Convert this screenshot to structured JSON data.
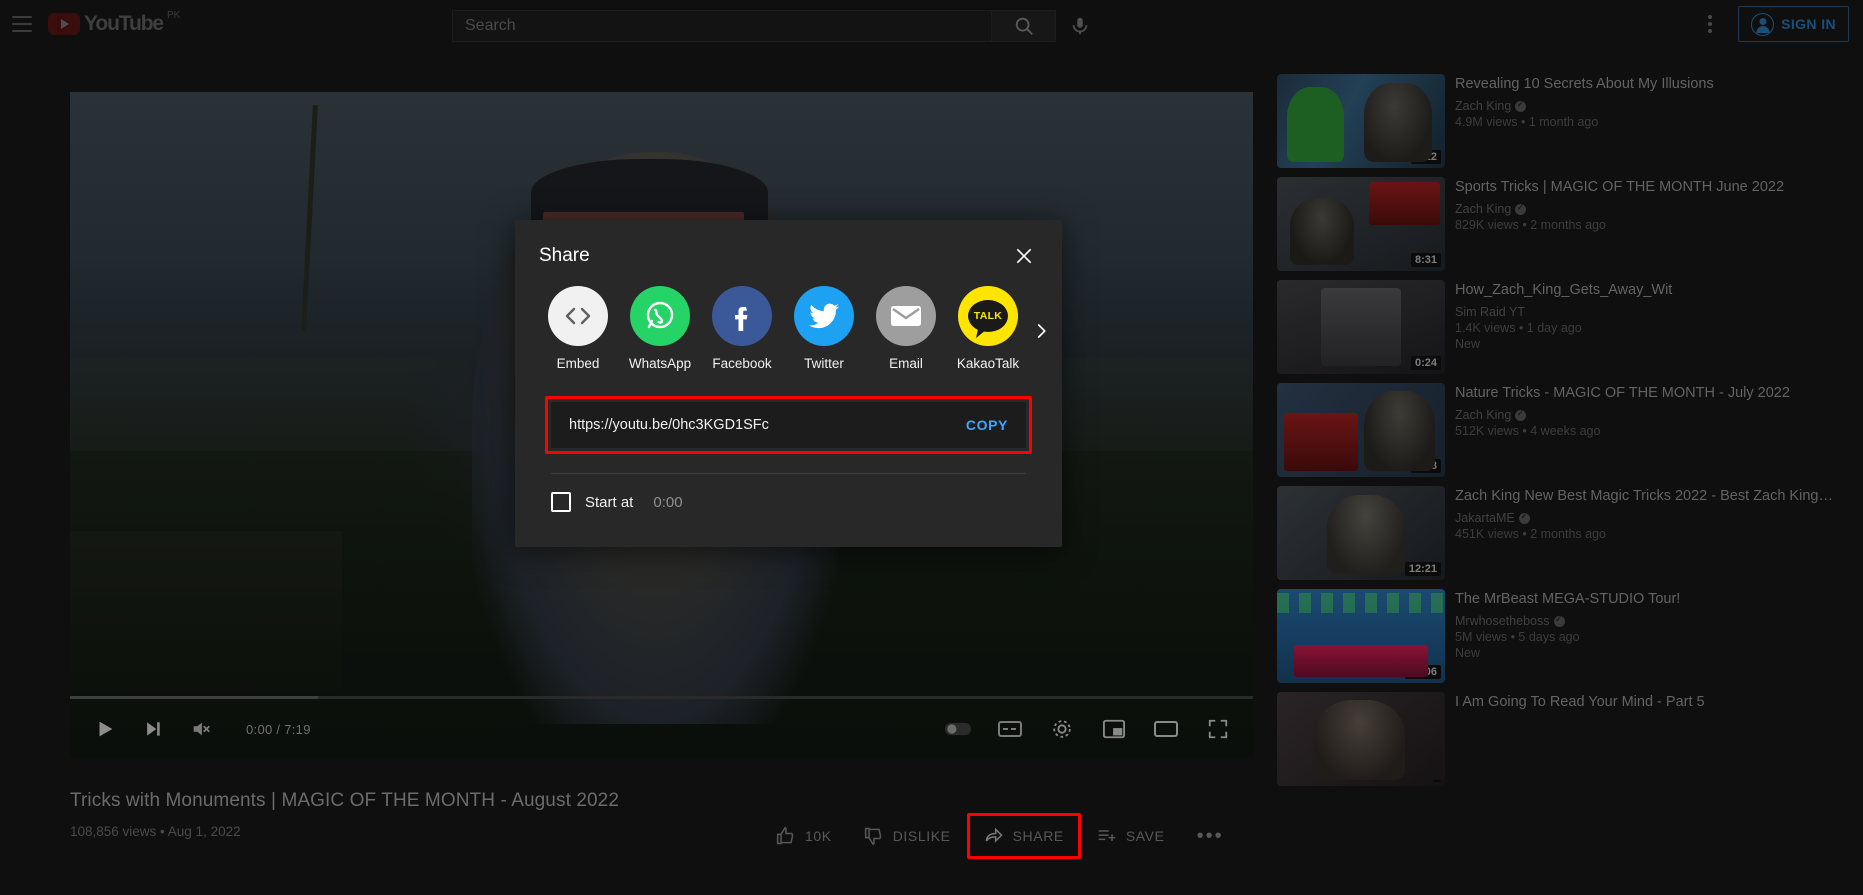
{
  "masthead": {
    "menu_icon": "hamburger-menu-icon",
    "logo_text": "YouTube",
    "logo_country": "PK",
    "search_placeholder": "Search",
    "search_icon": "search-icon",
    "mic_icon": "microphone-icon",
    "kebab_icon": "more-vertical-icon",
    "signin_label": "SIGN IN",
    "signin_icon": "account-circle-icon"
  },
  "player": {
    "play_icon": "play-icon",
    "next_icon": "next-track-icon",
    "mute_icon": "volume-muted-icon",
    "time": "0:00 / 7:19",
    "autoplay_icon": "autoplay-toggle-icon",
    "captions_icon": "closed-captions-icon",
    "settings_icon": "gear-icon",
    "miniplayer_icon": "miniplayer-icon",
    "theater_icon": "theater-mode-icon",
    "fullscreen_icon": "fullscreen-icon"
  },
  "video": {
    "title": "Tricks with Monuments | MAGIC OF THE MONTH - August 2022",
    "views_and_date": "108,856 views • Aug 1, 2022"
  },
  "actions": {
    "like_label": "10K",
    "like_icon": "thumbs-up-icon",
    "dislike_label": "DISLIKE",
    "dislike_icon": "thumbs-down-icon",
    "share_label": "SHARE",
    "share_icon": "share-arrow-icon",
    "save_label": "SAVE",
    "save_icon": "save-to-playlist-icon",
    "more_label": "•••"
  },
  "dialog": {
    "title": "Share",
    "close_icon": "close-icon",
    "next_arrow_icon": "chevron-right-icon",
    "targets": [
      {
        "label": "Embed",
        "icon": "code-brackets-icon",
        "color": "#f1f1f1"
      },
      {
        "label": "WhatsApp",
        "icon": "whatsapp-icon",
        "color": "#25d366"
      },
      {
        "label": "Facebook",
        "icon": "facebook-icon",
        "color": "#3b5998"
      },
      {
        "label": "Twitter",
        "icon": "twitter-bird-icon",
        "color": "#1da1f2"
      },
      {
        "label": "Email",
        "icon": "envelope-icon",
        "color": "#9e9e9e"
      },
      {
        "label": "KakaoTalk",
        "icon": "kakaotalk-icon",
        "color": "#fee500"
      }
    ],
    "kakao_text": "TALK",
    "url": "https://youtu.be/0hc3KGD1SFc",
    "copy_label": "COPY",
    "start_at_label": "Start at",
    "start_at_time": "0:00",
    "highlight_color": "#ff0000",
    "copy_color": "#3ea6ff"
  },
  "sidebar": {
    "videos": [
      {
        "title": "Revealing 10 Secrets About My Illusions",
        "channel": "Zach King",
        "verified": true,
        "stats": "4.9M views • 1 month ago",
        "duration": "7:12",
        "badge": ""
      },
      {
        "title": "Sports Tricks | MAGIC OF THE MONTH June 2022",
        "channel": "Zach King",
        "verified": true,
        "stats": "829K views • 2 months ago",
        "duration": "8:31",
        "badge": ""
      },
      {
        "title": "How_Zach_King_Gets_Away_Wit",
        "channel": "Sim Raid YT",
        "verified": false,
        "stats": "1.4K views • 1 day ago",
        "duration": "0:24",
        "badge": "New"
      },
      {
        "title": "Nature Tricks - MAGIC OF THE MONTH - July 2022",
        "channel": "Zach King",
        "verified": true,
        "stats": "512K views • 4 weeks ago",
        "duration": "5:48",
        "badge": ""
      },
      {
        "title": "Zach King New Best Magic Tricks 2022 - Best Zach King…",
        "channel": "JakartaME",
        "verified": true,
        "stats": "451K views • 2 months ago",
        "duration": "12:21",
        "badge": ""
      },
      {
        "title": "The MrBeast MEGA-STUDIO Tour!",
        "channel": "Mrwhosetheboss",
        "verified": true,
        "stats": "5M views • 5 days ago",
        "duration": "18:06",
        "badge": "New"
      },
      {
        "title": "I Am Going To Read Your Mind - Part 5",
        "channel": "",
        "verified": false,
        "stats": "",
        "duration": "",
        "badge": ""
      }
    ]
  }
}
